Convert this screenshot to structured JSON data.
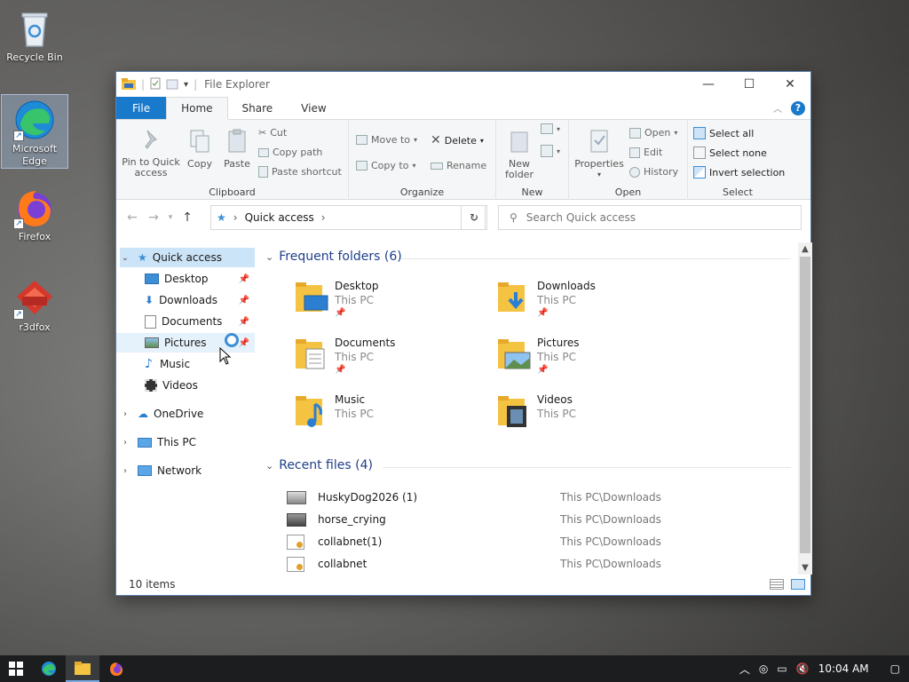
{
  "desktop": {
    "icons": [
      {
        "label": "Recycle Bin"
      },
      {
        "label": "Microsoft Edge"
      },
      {
        "label": "Firefox"
      },
      {
        "label": "r3dfox"
      }
    ]
  },
  "window": {
    "title": "File Explorer",
    "tabs": {
      "file": "File",
      "home": "Home",
      "share": "Share",
      "view": "View"
    }
  },
  "ribbon": {
    "clipboard": {
      "label": "Clipboard",
      "pin_to_quick_access": "Pin to Quick access",
      "copy": "Copy",
      "paste": "Paste",
      "cut": "Cut",
      "copy_path": "Copy path",
      "paste_shortcut": "Paste shortcut"
    },
    "organize": {
      "label": "Organize",
      "move_to": "Move to",
      "copy_to": "Copy to",
      "delete": "Delete",
      "rename": "Rename"
    },
    "new": {
      "label": "New",
      "new_folder": "New folder"
    },
    "open": {
      "label": "Open",
      "properties": "Properties",
      "open": "Open",
      "edit": "Edit",
      "history": "History"
    },
    "select": {
      "label": "Select",
      "select_all": "Select all",
      "select_none": "Select none",
      "invert_selection": "Invert selection"
    }
  },
  "address": {
    "location": "Quick access",
    "search_placeholder": "Search Quick access"
  },
  "nav": {
    "quick_access": "Quick access",
    "items": [
      "Desktop",
      "Downloads",
      "Documents",
      "Pictures",
      "Music",
      "Videos"
    ],
    "onedrive": "OneDrive",
    "this_pc": "This PC",
    "network": "Network"
  },
  "content": {
    "frequent_header": "Frequent folders (6)",
    "folders": [
      {
        "name": "Desktop",
        "location": "This PC"
      },
      {
        "name": "Downloads",
        "location": "This PC"
      },
      {
        "name": "Documents",
        "location": "This PC"
      },
      {
        "name": "Pictures",
        "location": "This PC"
      },
      {
        "name": "Music",
        "location": "This PC"
      },
      {
        "name": "Videos",
        "location": "This PC"
      }
    ],
    "recent_header": "Recent files (4)",
    "recent": [
      {
        "name": "HuskyDog2026 (1)",
        "path": "This PC\\Downloads"
      },
      {
        "name": "horse_crying",
        "path": "This PC\\Downloads"
      },
      {
        "name": "collabnet(1)",
        "path": "This PC\\Downloads"
      },
      {
        "name": "collabnet",
        "path": "This PC\\Downloads"
      }
    ]
  },
  "status": {
    "items": "10 items"
  },
  "taskbar": {
    "time": "10:04 AM"
  }
}
